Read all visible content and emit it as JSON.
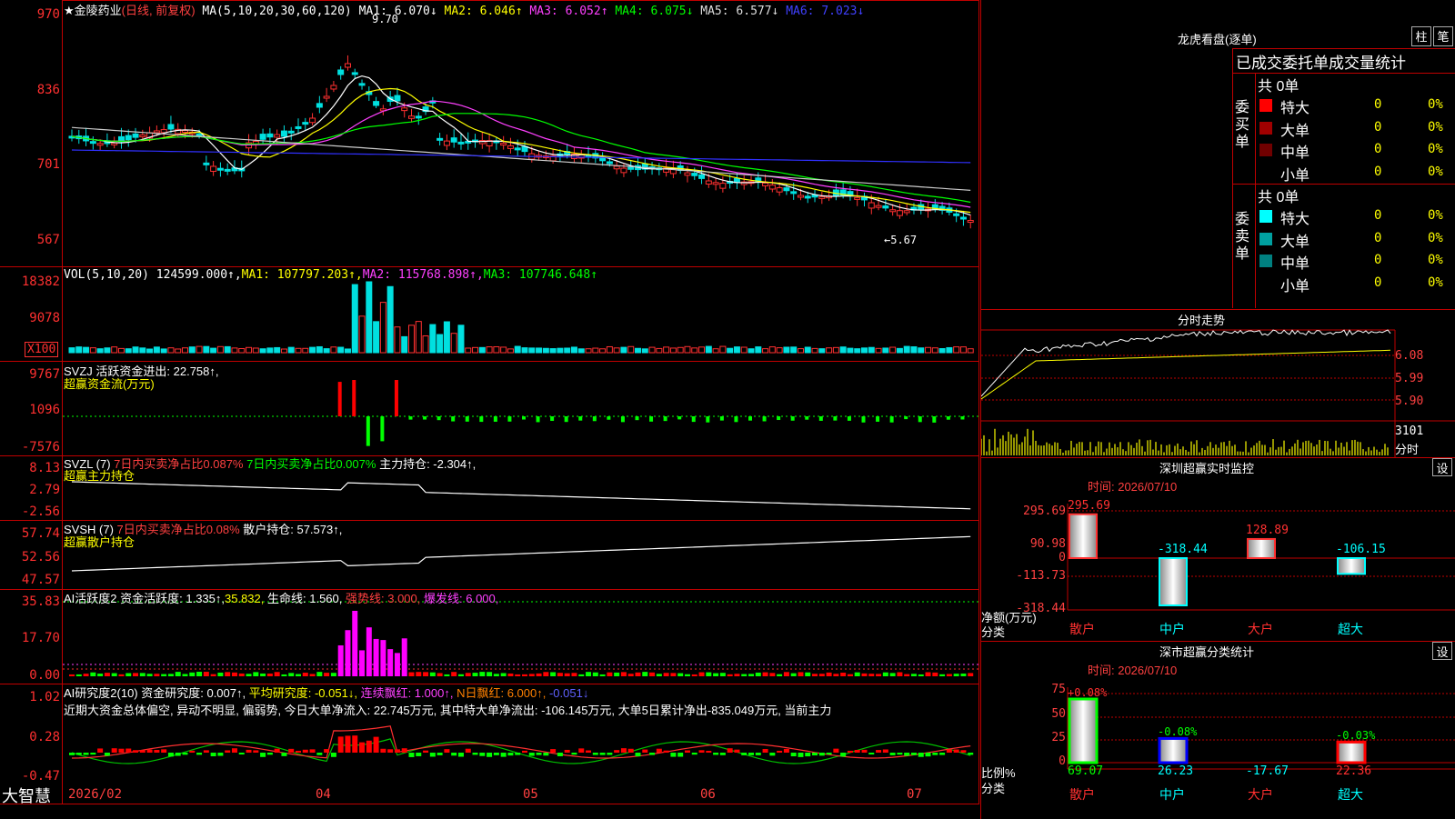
{
  "main": {
    "stock_name": "金陵药业",
    "mode": "(日线, 前复权)",
    "ma_params": "MA(5,10,20,30,60,120)",
    "ma_values": [
      {
        "label": "MA1: 6.070↓",
        "color": "#ffffff"
      },
      {
        "label": "MA2: 6.046↑",
        "color": "#ffff00"
      },
      {
        "label": "MA3: 6.052↑",
        "color": "#ff40ff"
      },
      {
        "label": "MA4: 6.075↓",
        "color": "#00ff00"
      },
      {
        "label": "MA5: 6.577↓",
        "color": "#dddddd"
      },
      {
        "label": "MA6: 7.023↓",
        "color": "#4040ff"
      }
    ],
    "y_ticks": [
      "970",
      "836",
      "701",
      "567"
    ],
    "high_marker": "9.70",
    "low_marker": "←5.67"
  },
  "vol": {
    "title": "VOL(5,10,20)",
    "value": "124599.000↑,",
    "ma1": "MA1: 107797.203↑,",
    "ma2": "MA2: 115768.898↑,",
    "ma3": "MA3: 107746.648↑",
    "y_ticks": [
      "18382",
      "9078"
    ],
    "unit_badge": "X100"
  },
  "svzj": {
    "title": "SVZJ  活跃资金进出: 22.758↑,",
    "subtitle": "超赢资金流(万元)",
    "y_ticks": [
      "9767",
      "1096",
      "-7576"
    ]
  },
  "svzl": {
    "title": "SVZL (7)",
    "t1": "7日内买卖净占比0.087%",
    "t2": "7日内买卖净占比0.007%",
    "t3": "主力持仓: -2.304↑,",
    "subtitle": "超赢主力持仓",
    "y_ticks": [
      "8.13",
      "2.79",
      "-2.56"
    ]
  },
  "svsh": {
    "title": "SVSH (7)",
    "t1": "7日内买卖净占比0.08%",
    "t2": "散户持仓: 57.573↑,",
    "subtitle": "超赢散户持仓",
    "y_ticks": [
      "57.74",
      "52.56",
      "47.57"
    ]
  },
  "ai1": {
    "title": "AI活跃度2 资金活跃度: 1.335↑,",
    "t1": "35.832,",
    "t2": "生命线: 1.560,",
    "t3": "强势线: 3.000,",
    "t4": "爆发线: 6.000,",
    "y_ticks": [
      "35.83",
      "17.70",
      "0.00"
    ]
  },
  "ai2": {
    "title": "AI研究度2(10) 资金研究度: 0.007↑,",
    "t1": "平均研究度: -0.051↓,",
    "t2": "连续飘红: 1.000↑,",
    "t3": "N日飘红: 6.000↑,",
    "t4": "-0.051↓",
    "summary": "近期大资金总体偏空, 异动不明显, 偏弱势, 今日大单净流入: 22.745万元, 其中特大单净流出: -106.145万元, 大单5日累计净出-835.049万元, 当前主力",
    "y_ticks": [
      "1.02",
      "0.28",
      "-0.47"
    ]
  },
  "footer": {
    "brand": "大智慧",
    "dates": [
      "2026/02",
      "04",
      "05",
      "06",
      "07"
    ]
  },
  "dragon": {
    "title": "龙虎看盘(逐单)",
    "btn1": "柱",
    "btn2": "笔",
    "header": "已成交委托单成交量统计",
    "buy_label": "委买单",
    "sell_label": "委卖单",
    "buy_total": "共 0单",
    "sell_total": "共 0单",
    "buy_rows": [
      {
        "name": "特大",
        "val": "0",
        "pct": "0%",
        "color": "#ff0000"
      },
      {
        "name": "大单",
        "val": "0",
        "pct": "0%",
        "color": "#a00000"
      },
      {
        "name": "中单",
        "val": "0",
        "pct": "0%",
        "color": "#700000"
      },
      {
        "name": "小单",
        "val": "0",
        "pct": "0%",
        "color": ""
      }
    ],
    "sell_rows": [
      {
        "name": "特大",
        "val": "0",
        "pct": "0%",
        "color": "#00ffff"
      },
      {
        "name": "大单",
        "val": "0",
        "pct": "0%",
        "color": "#00a0a0"
      },
      {
        "name": "中单",
        "val": "0",
        "pct": "0%",
        "color": "#008080"
      },
      {
        "name": "小单",
        "val": "0",
        "pct": "0%",
        "color": ""
      }
    ]
  },
  "intraday": {
    "title": "分时走势",
    "y_ticks": [
      "6.08",
      "5.99",
      "5.90"
    ],
    "vol_tick": "3101",
    "vol_unit": "分时"
  },
  "monitor": {
    "title": "深圳超赢实时监控",
    "setting": "设",
    "time": "时间: 2026/07/10",
    "y_ticks": [
      "295.69",
      "90.98",
      "0",
      "-113.73",
      "-318.44"
    ],
    "y_label": "净额(万元)",
    "x_label": "分类",
    "categories": [
      "散户",
      "中户",
      "大户",
      "超大"
    ],
    "values": [
      295.69,
      -318.44,
      128.89,
      -106.15
    ],
    "value_labels": [
      "295.69",
      "-318.44",
      "128.89",
      "-106.15"
    ]
  },
  "classify": {
    "title": "深市超赢分类统计",
    "setting": "设",
    "time": "时间: 2026/07/10",
    "y_ticks": [
      "75",
      "50",
      "25",
      "0"
    ],
    "y_label": "比例%",
    "x_label": "分类",
    "categories": [
      "散户",
      "中户",
      "大户",
      "超大"
    ],
    "top_labels": [
      "+0.08%",
      "-0.08%",
      "",
      "-0.03%"
    ],
    "bottom_labels": [
      "69.07",
      "26.23",
      "-17.67",
      "22.36"
    ],
    "values": [
      69.07,
      26.23,
      0,
      22.36
    ]
  }
}
